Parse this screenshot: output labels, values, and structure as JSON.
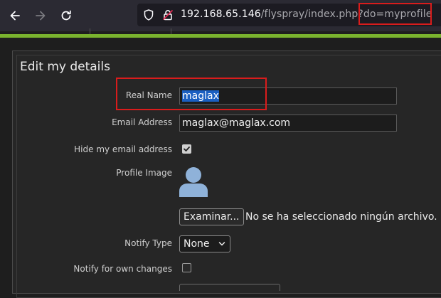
{
  "browser": {
    "url_host": "192.168.65.146",
    "url_path": "/flyspray/index.php?",
    "url_query": "do=myprofile"
  },
  "colors": {
    "accent_green": "#7ab32e",
    "highlight_red": "#d91c1c",
    "selection_blue": "#1b5fc1"
  },
  "form": {
    "title": "Edit my details",
    "real_name_label": "Real Name",
    "real_name_value": "maglax",
    "email_label": "Email Address",
    "email_value": "maglax@maglax.com",
    "hide_email_label": "Hide my email address",
    "hide_email_checked": true,
    "profile_image_label": "Profile Image",
    "browse_button": "Examinar...",
    "no_file_text": "No se ha seleccionado ningún archivo.",
    "notify_type_label": "Notify Type",
    "notify_type_value": "None",
    "notify_own_label": "Notify for own changes",
    "notify_own_checked": false
  }
}
